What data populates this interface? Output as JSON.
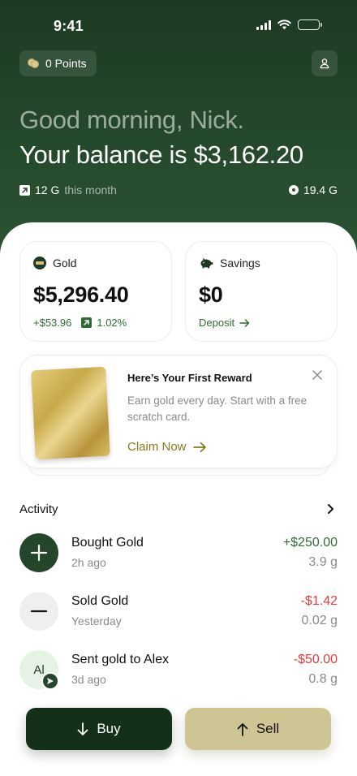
{
  "status_bar": {
    "time": "9:41"
  },
  "header": {
    "points_label": "0 Points",
    "greeting": "Good morning, Nick.",
    "balance_line": "Your balance is $3,162.20",
    "month_value": "12 G",
    "month_suffix": "this month",
    "total_gold": "19.4 G"
  },
  "gold_card": {
    "label": "Gold",
    "value": "$5,296.40",
    "change_amount": "+$53.96",
    "change_percent": "1.02%"
  },
  "savings_card": {
    "label": "Savings",
    "value": "$0",
    "action": "Deposit"
  },
  "reward": {
    "title": "Here’s Your First Reward",
    "description": "Earn gold every day. Start with a free scratch card.",
    "cta": "Claim Now"
  },
  "activity": {
    "title": "Activity",
    "items": [
      {
        "title": "Bought Gold",
        "time": "2h ago",
        "amount": "+$250.00",
        "grams": "3.9 g",
        "kind": "buy"
      },
      {
        "title": "Sold Gold",
        "time": "Yesterday",
        "amount": "-$1.42",
        "grams": "0.02 g",
        "kind": "sell"
      },
      {
        "title": "Sent gold to Alex",
        "time": "3d ago",
        "amount": "-$50.00",
        "grams": "0.8 g",
        "kind": "send",
        "initials": "Al"
      }
    ]
  },
  "actions": {
    "buy": "Buy",
    "sell": "Sell"
  },
  "colors": {
    "brand_dark": "#1d3a22",
    "positive": "#2f6b33",
    "negative": "#e23c3c",
    "gold_accent": "#8a7a1e",
    "sell_button": "#cfc594"
  }
}
